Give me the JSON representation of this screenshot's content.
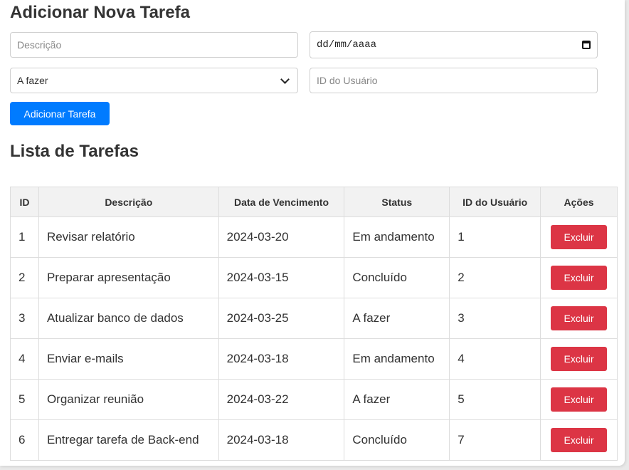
{
  "form": {
    "title": "Adicionar Nova Tarefa",
    "description_placeholder": "Descrição",
    "date_display": "dd/mm/aaaa",
    "status_selected": "A fazer",
    "user_id_placeholder": "ID do Usuário",
    "submit_label": "Adicionar Tarefa"
  },
  "list": {
    "title": "Lista de Tarefas",
    "headers": [
      "ID",
      "Descrição",
      "Data de Vencimento",
      "Status",
      "ID do Usuário",
      "Ações"
    ],
    "delete_label": "Excluir",
    "rows": [
      {
        "id": "1",
        "description": "Revisar relatório",
        "due_date": "2024-03-20",
        "status": "Em andamento",
        "user_id": "1"
      },
      {
        "id": "2",
        "description": "Preparar apresentação",
        "due_date": "2024-03-15",
        "status": "Concluído",
        "user_id": "2"
      },
      {
        "id": "3",
        "description": "Atualizar banco de dados",
        "due_date": "2024-03-25",
        "status": "A fazer",
        "user_id": "3"
      },
      {
        "id": "4",
        "description": "Enviar e-mails",
        "due_date": "2024-03-18",
        "status": "Em andamento",
        "user_id": "4"
      },
      {
        "id": "5",
        "description": "Organizar reunião",
        "due_date": "2024-03-22",
        "status": "A fazer",
        "user_id": "5"
      },
      {
        "id": "6",
        "description": "Entregar tarefa de Back-end",
        "due_date": "2024-03-18",
        "status": "Concluído",
        "user_id": "7"
      }
    ]
  },
  "colors": {
    "primary_button": "#007bff",
    "danger_button": "#dc3545",
    "header_background": "#f2f2f2"
  },
  "icons": {
    "date_picker": "calendar-icon",
    "select": "chevron-down-icon"
  }
}
